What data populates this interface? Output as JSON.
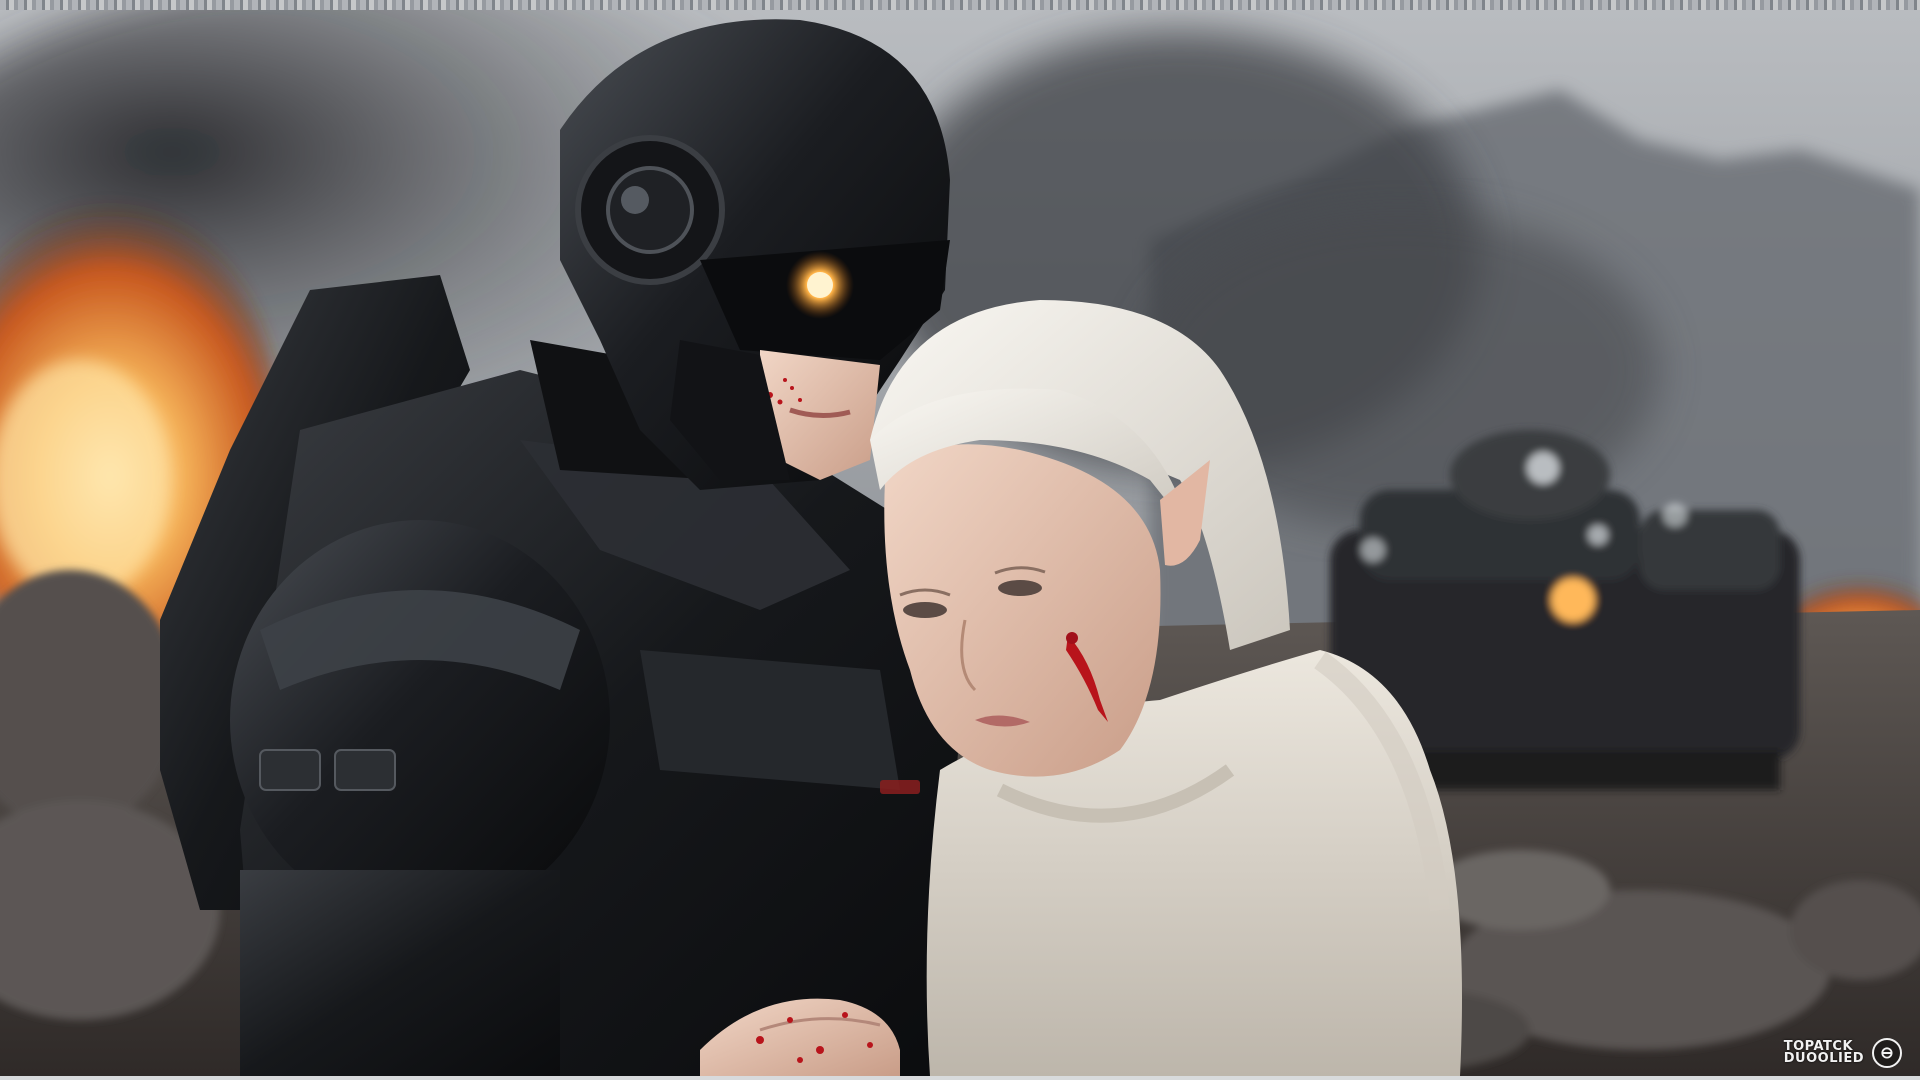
{
  "image": {
    "subject": "armored-robot-soldier-and-white-haired-woman",
    "setting": "smoky-battlefield-with-fire-and-vehicle"
  },
  "watermark": {
    "line1": "TOPATCK",
    "line2": "DUOOLIED",
    "logo_glyph": "⊖"
  },
  "palette": {
    "sky": "#9a9ea3",
    "smoke": "#3b3d40",
    "fire": "#f0a548",
    "armor": "#1a1c1f",
    "eye_glow": "#ffb347",
    "hair": "#e9e6df",
    "hoodie": "#e2ddd3",
    "skin": "#e9c9b6",
    "blood": "#b8141b",
    "ground": "#4a4542"
  }
}
